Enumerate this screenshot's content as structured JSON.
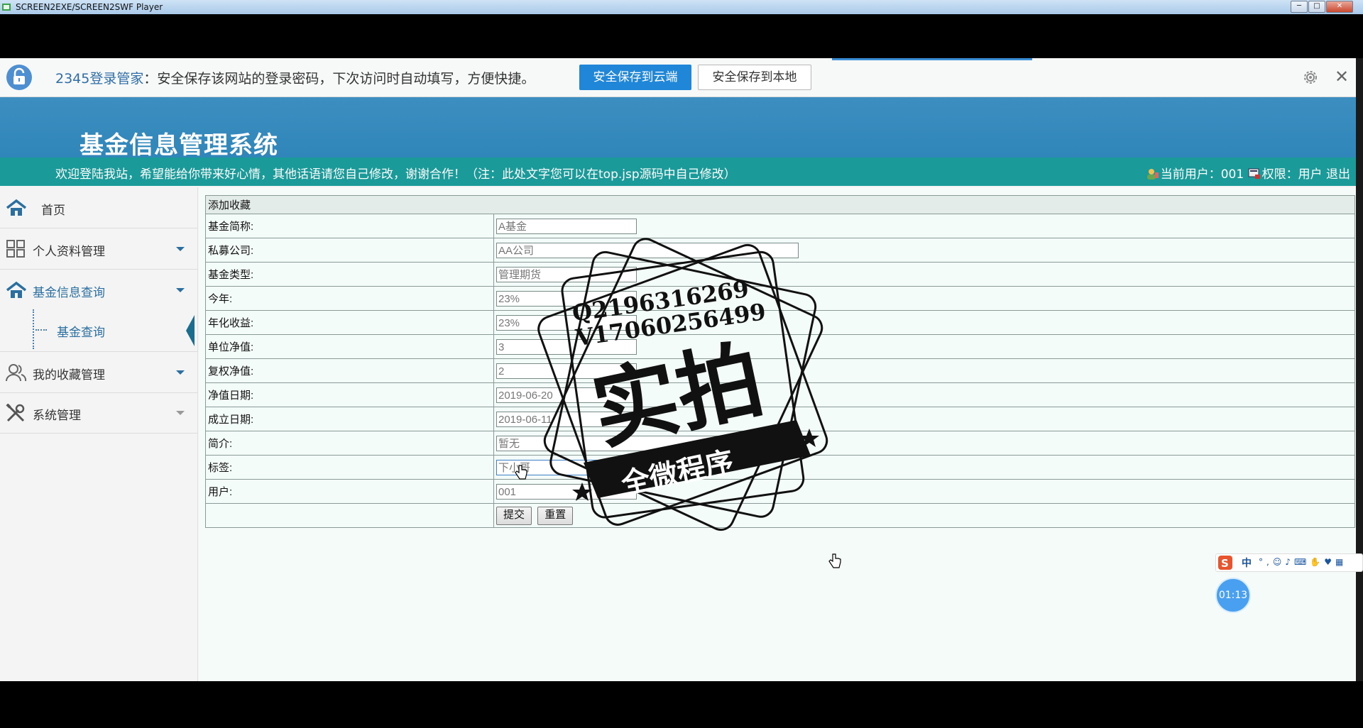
{
  "window": {
    "title": "SCREEN2EXE/SCREEN2SWF Player"
  },
  "password_bar": {
    "brand": "2345登录管家",
    "message": "：安全保存该网站的登录密码，下次访问时自动填写，方便快捷。",
    "save_cloud_label": "安全保存到云端",
    "save_local_label": "安全保存到本地",
    "close_glyph": "✕"
  },
  "header": {
    "system_title": "基金信息管理系统",
    "welcome_text": "欢迎登陆我站，希望能给你带来好心情，其他话语请您自己修改，谢谢合作！（注：此处文字您可以在top.jsp源码中自己修改）",
    "current_user_label": "当前用户：001",
    "permission_label": "权限：用户",
    "logout_label": "退出"
  },
  "sidebar": {
    "items": [
      {
        "label": "首页"
      },
      {
        "label": "个人资料管理"
      },
      {
        "label": "基金信息查询"
      },
      {
        "label": "我的收藏管理"
      },
      {
        "label": "系统管理"
      }
    ],
    "sub_item": {
      "label": "基金查询"
    }
  },
  "form": {
    "title": "添加收藏",
    "fields": [
      {
        "label": "基金简称:",
        "value": "A基金"
      },
      {
        "label": "私募公司:",
        "value": "AA公司"
      },
      {
        "label": "基金类型:",
        "value": "管理期货"
      },
      {
        "label": "今年:",
        "value": "23%"
      },
      {
        "label": "年化收益:",
        "value": "23%"
      },
      {
        "label": "单位净值:",
        "value": "3"
      },
      {
        "label": "复权净值:",
        "value": "2"
      },
      {
        "label": "净值日期:",
        "value": "2019-06-20"
      },
      {
        "label": "成立日期:",
        "value": "2019-06-11"
      },
      {
        "label": "简介:",
        "value": "暂无"
      },
      {
        "label": "标签:",
        "value": "下小哥"
      },
      {
        "label": "用户:",
        "value": "001"
      }
    ],
    "submit_label": "提交",
    "reset_label": "重置"
  },
  "watermark": {
    "line1": "Q2196316269",
    "line2": "V17060256499",
    "big_text": "实拍",
    "ribbon_text": "全微程序"
  },
  "ime_bar": {
    "lang": "中"
  },
  "timer": {
    "time": "01:13"
  },
  "colors": {
    "header_blue": "#3d8ec0",
    "welcome_teal": "#1a9a98",
    "nav_blue": "#2a6fa0",
    "button_blue": "#1f86d8"
  }
}
